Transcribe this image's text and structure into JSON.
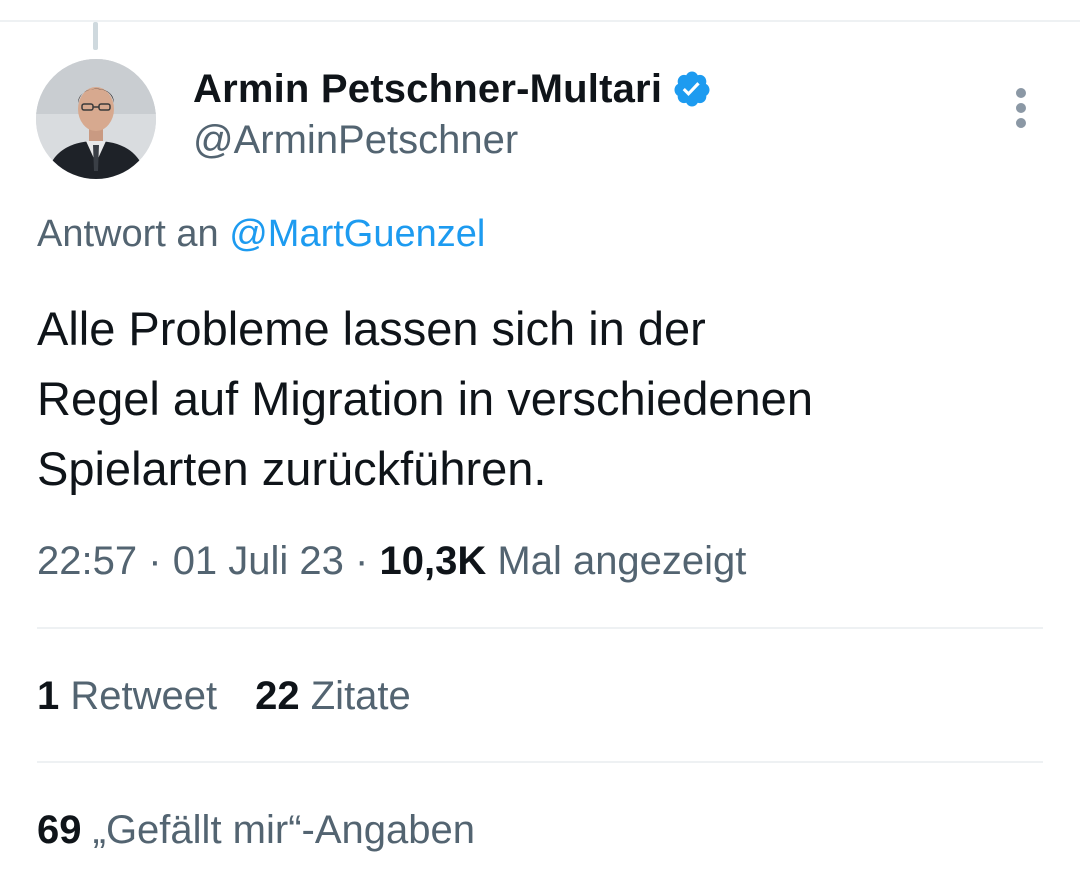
{
  "tweet": {
    "author": {
      "display_name": "Armin Petschner-Multari",
      "handle": "@ArminPetschner",
      "verified": true,
      "verified_color": "#1d9bf0"
    },
    "reply_prefix": "Antwort an",
    "reply_to": "@MartGuenzel",
    "text_lines": [
      "Alle Probleme lassen sich in der",
      "Regel auf Migration in verschiedenen",
      "Spielarten zurückführen."
    ],
    "time": "22:57",
    "separator": "·",
    "date": "01 Juli 23",
    "views_count": "10,3K",
    "views_label": "Mal angezeigt",
    "retweets_count": "1",
    "retweets_label": "Retweet",
    "quotes_count": "22",
    "quotes_label": "Zitate",
    "likes_count": "69",
    "likes_label": "„Gefällt mir“-Angaben"
  },
  "icons": {
    "verified": "verified-badge-icon",
    "more": "more-vertical-icon"
  },
  "colors": {
    "accent": "#1d9bf0",
    "text_primary": "#0f1419",
    "text_secondary": "#536471",
    "divider": "#eef1f3"
  }
}
